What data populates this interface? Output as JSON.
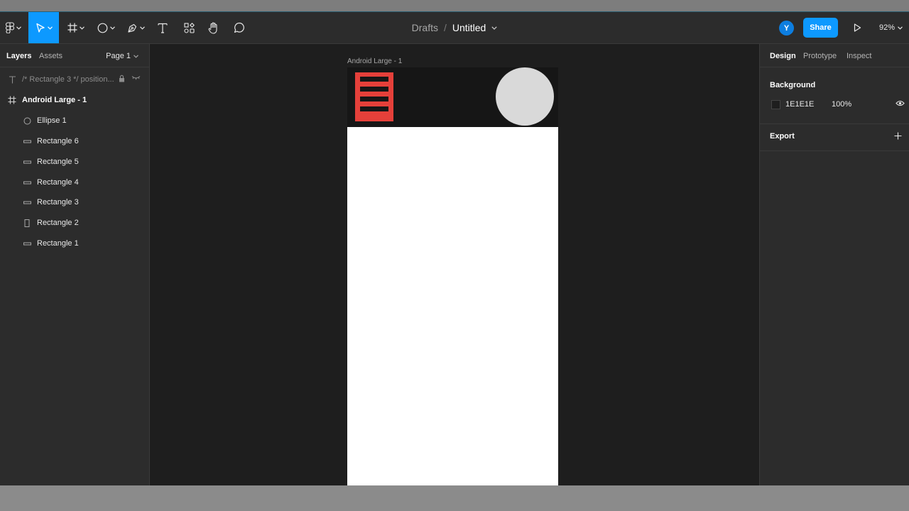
{
  "toolbar": {
    "main_menu_icon": "figma-logo-icon",
    "tools": [
      {
        "name": "move-tool",
        "icon": "cursor-arrow-icon"
      },
      {
        "name": "frame-tool",
        "icon": "hash-frame-icon"
      },
      {
        "name": "shape-tool",
        "icon": "circle-icon"
      },
      {
        "name": "pen-tool",
        "icon": "pen-icon"
      },
      {
        "name": "text-tool",
        "icon": "text-t-icon"
      },
      {
        "name": "resources-tool",
        "icon": "components-icon"
      },
      {
        "name": "hand-tool",
        "icon": "hand-icon"
      },
      {
        "name": "comment-tool",
        "icon": "comment-icon"
      }
    ],
    "breadcrumb_parent": "Drafts",
    "breadcrumb_separator": "/",
    "file_name": "Untitled",
    "avatar_initial": "Y",
    "share_label": "Share",
    "zoom_label": "92%",
    "accent_color": "#0d99ff"
  },
  "left_panel": {
    "tabs": [
      "Layers",
      "Assets"
    ],
    "page_selector": "Page 1",
    "layers": [
      {
        "label": "/* Rectangle 3 */ position...",
        "icon": "text-t-icon"
      },
      {
        "label": "Android Large - 1",
        "icon": "hash-frame-icon"
      },
      {
        "label": "Ellipse 1",
        "icon": "ellipse-icon"
      },
      {
        "label": "Rectangle 6",
        "icon": "rectangle-line-icon"
      },
      {
        "label": "Rectangle 5",
        "icon": "rectangle-line-icon"
      },
      {
        "label": "Rectangle 4",
        "icon": "rectangle-line-icon"
      },
      {
        "label": "Rectangle 3",
        "icon": "rectangle-line-icon"
      },
      {
        "label": "Rectangle 2",
        "icon": "rectangle-tall-icon"
      },
      {
        "label": "Rectangle 1",
        "icon": "rectangle-line-icon"
      }
    ]
  },
  "canvas": {
    "frame_label": "Android Large - 1",
    "frame_bg": "#ffffff",
    "header_bg": "#161616",
    "menu_color": "#e5403a",
    "circle_color": "#d9d9d9"
  },
  "right_panel": {
    "tabs": [
      "Design",
      "Prototype",
      "Inspect"
    ],
    "background_title": "Background",
    "background_hex": "1E1E1E",
    "background_opacity": "100%",
    "export_title": "Export"
  }
}
